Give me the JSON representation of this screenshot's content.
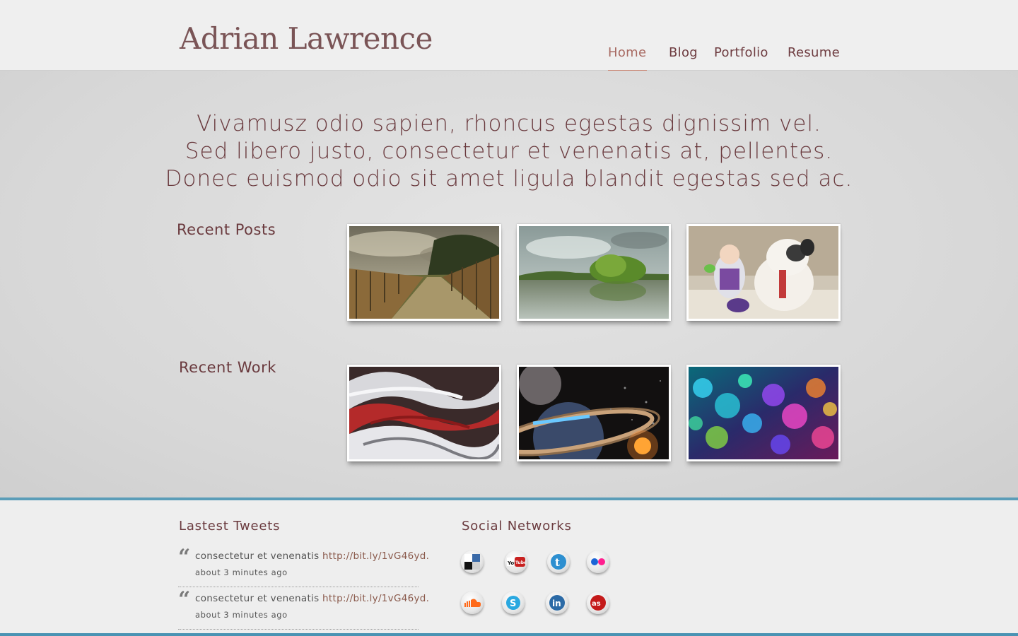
{
  "site": {
    "logo": "Adrian Lawrence"
  },
  "nav": {
    "items": [
      {
        "label": "Home",
        "active": true
      },
      {
        "label": "Blog",
        "active": false
      },
      {
        "label": "Portfolio",
        "active": false
      },
      {
        "label": "Resume",
        "active": false
      }
    ]
  },
  "hero": {
    "lines": [
      "Vivamusz odio sapien, rhoncus egestas dignissim vel.",
      "Sed libero justo, consectetur et venenatis at, pellentes.",
      "Donec euismod odio sit amet ligula blandit egestas sed ac."
    ]
  },
  "recent_posts": {
    "label": "Recent Posts",
    "thumbnails": [
      "boardwalk-photo",
      "lake-island-photo",
      "toys-photo"
    ]
  },
  "recent_work": {
    "label": "Recent Work",
    "thumbnails": [
      "abstract-3d-render",
      "planet-space-art",
      "bokeh-lights"
    ]
  },
  "footer": {
    "tweets_heading": "Lastest Tweets",
    "tweets": [
      {
        "text": "consectetur et venenatis ",
        "link": "http://bit.ly/1vG46yd.",
        "time": "about 3 minutes ago"
      },
      {
        "text": "consectetur et venenatis ",
        "link": "http://bit.ly/1vG46yd.",
        "time": "about 3 minutes ago"
      }
    ],
    "social_heading": "Social Networks",
    "social": [
      {
        "name": "delicious-icon"
      },
      {
        "name": "youtube-icon"
      },
      {
        "name": "twitter-icon"
      },
      {
        "name": "flickr-icon"
      },
      {
        "name": "soundcloud-icon"
      },
      {
        "name": "skype-icon"
      },
      {
        "name": "linkedin-icon"
      },
      {
        "name": "lastfm-icon"
      }
    ]
  },
  "colors": {
    "accent": "#c9826f",
    "text": "#6a3a3e",
    "footer_border": "#5b9db8"
  }
}
